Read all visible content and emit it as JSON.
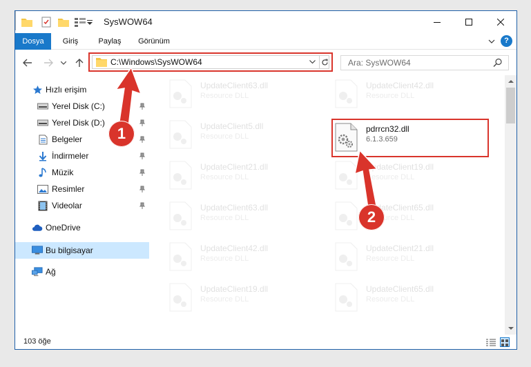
{
  "window": {
    "title": "SysWOW64"
  },
  "ribbon": {
    "tabs": [
      "Dosya",
      "Giriş",
      "Paylaş",
      "Görünüm"
    ],
    "help": "?"
  },
  "address": {
    "path": "C:\\Windows\\SysWOW64"
  },
  "search": {
    "placeholder": "Ara: SysWOW64"
  },
  "sidebar": {
    "items": [
      {
        "label": "Hızlı erişim",
        "icon": "star-icon"
      },
      {
        "label": "Yerel Disk (C:)",
        "icon": "drive-icon"
      },
      {
        "label": "Yerel Disk (D:)",
        "icon": "drive-icon"
      },
      {
        "label": "Belgeler",
        "icon": "documents-icon"
      },
      {
        "label": "İndirmeler",
        "icon": "download-icon"
      },
      {
        "label": "Müzik",
        "icon": "music-icon"
      },
      {
        "label": "Resimler",
        "icon": "pictures-icon"
      },
      {
        "label": "Videolar",
        "icon": "videos-icon"
      },
      {
        "label": "OneDrive",
        "icon": "cloud-icon"
      },
      {
        "label": "Bu bilgisayar",
        "icon": "computer-icon"
      },
      {
        "label": "Ağ",
        "icon": "network-icon"
      }
    ]
  },
  "files": [
    {
      "name": "UpdateClient63.dll",
      "sub": "Resource DLL"
    },
    {
      "name": "UpdateClient42.dll",
      "sub": "Resource DLL"
    },
    {
      "name": "UpdateClient5.dll",
      "sub": "Resource DLL"
    },
    {
      "name": "pdrrcn32.dll",
      "sub": "6.1.3.659"
    },
    {
      "name": "UpdateClient21.dll",
      "sub": "Resource DLL"
    },
    {
      "name": "UpdateClient19.dll",
      "sub": "Resource DLL"
    },
    {
      "name": "UpdateClient63.dll",
      "sub": "Resource DLL"
    },
    {
      "name": "UpdateClient65.dll",
      "sub": "Resource DLL"
    },
    {
      "name": "UpdateClient42.dll",
      "sub": "Resource DLL"
    },
    {
      "name": "UpdateClient21.dll",
      "sub": "Resource DLL"
    },
    {
      "name": "UpdateClient19.dll",
      "sub": "Resource DLL"
    },
    {
      "name": "UpdateClient65.dll",
      "sub": "Resource DLL"
    }
  ],
  "status": {
    "count": "103 öğe"
  },
  "annotations": {
    "step1": "1",
    "step2": "2"
  },
  "colors": {
    "accent": "#1979ca",
    "highlight": "#d9342b",
    "selected": "#cce8ff"
  }
}
